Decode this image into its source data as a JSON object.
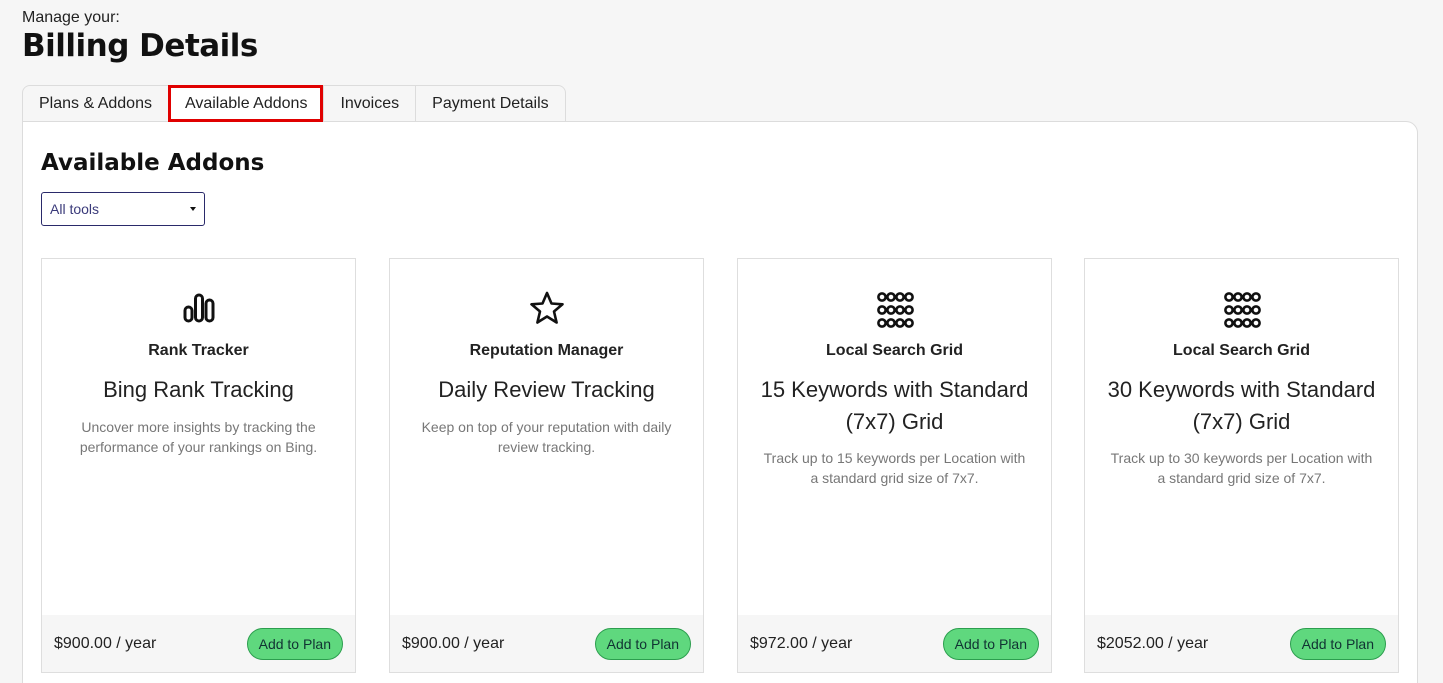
{
  "header": {
    "subtitle": "Manage your:",
    "title": "Billing Details"
  },
  "tabs": [
    {
      "label": "Plans & Addons"
    },
    {
      "label": "Available Addons"
    },
    {
      "label": "Invoices"
    },
    {
      "label": "Payment Details"
    }
  ],
  "active_tab": "Available Addons",
  "section": {
    "title": "Available Addons",
    "filter_value": "All tools"
  },
  "cards": [
    {
      "icon": "bar-chart-icon",
      "tool": "Rank Tracker",
      "name": "Bing Rank Tracking",
      "description": "Uncover more insights by tracking the performance of your rankings on Bing.",
      "price": "$900.00 / year",
      "button": "Add to Plan"
    },
    {
      "icon": "star-icon",
      "tool": "Reputation Manager",
      "name": "Daily Review Tracking",
      "description": "Keep on top of your reputation with daily review tracking.",
      "price": "$900.00 / year",
      "button": "Add to Plan"
    },
    {
      "icon": "grid-dots-icon",
      "tool": "Local Search Grid",
      "name": "15 Keywords with Standard (7x7) Grid",
      "description": "Track up to 15 keywords per Location with a standard grid size of 7x7.",
      "price": "$972.00 / year",
      "button": "Add to Plan"
    },
    {
      "icon": "grid-dots-icon",
      "tool": "Local Search Grid",
      "name": "30 Keywords with Standard (7x7) Grid",
      "description": "Track up to 30 keywords per Location with a standard grid size of 7x7.",
      "price": "$2052.00 / year",
      "button": "Add to Plan"
    }
  ],
  "colors": {
    "active_tab_outline": "#e00000",
    "add_button": "#5fd87e"
  }
}
